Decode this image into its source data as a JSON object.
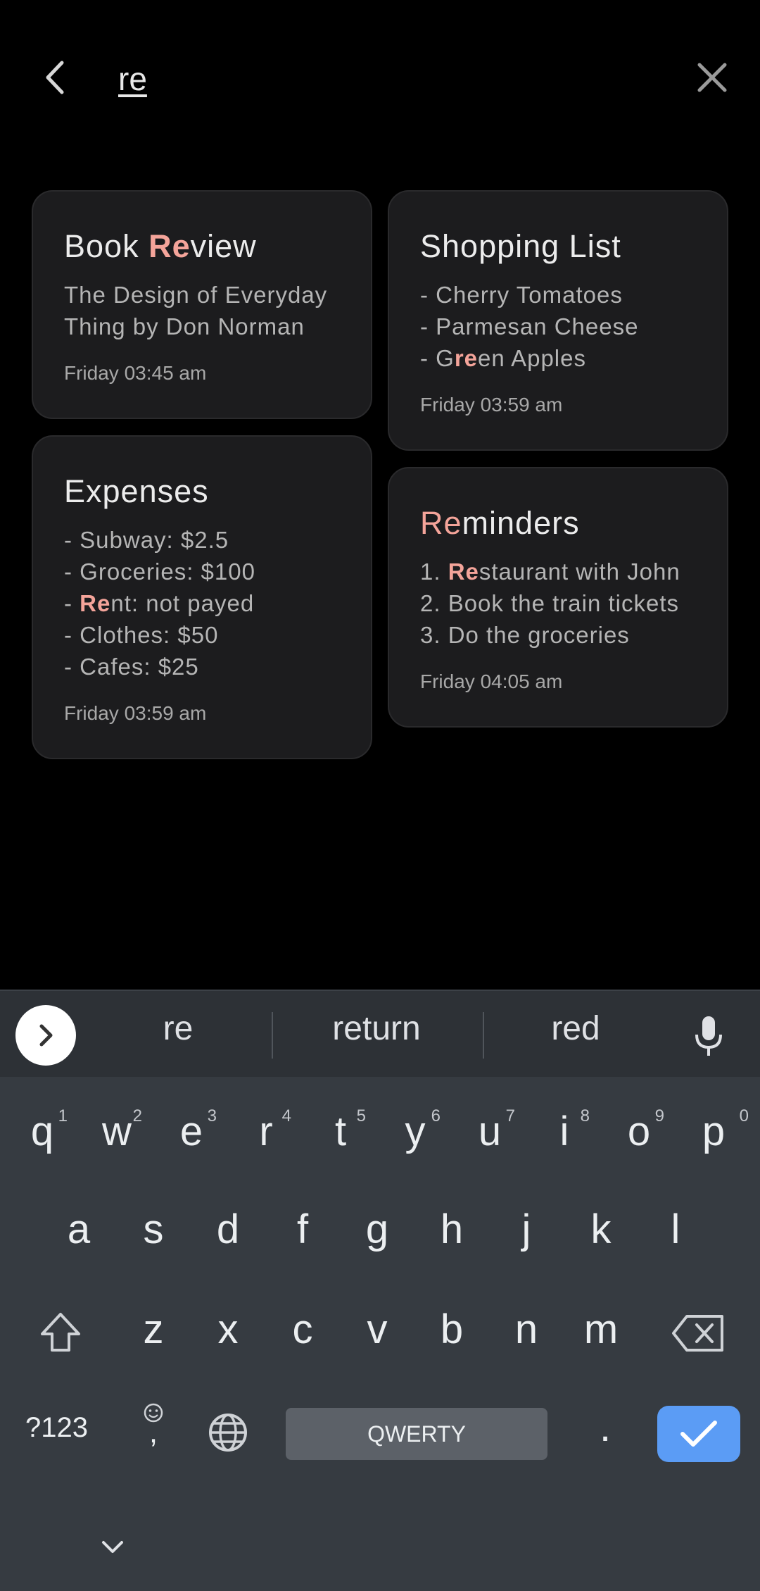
{
  "search": {
    "query": "re",
    "back_icon": "arrow-back-icon",
    "clear_icon": "close-icon"
  },
  "notes": [
    {
      "title_parts": [
        "Book ",
        "Re",
        "view"
      ],
      "body": [
        "The Design of Everyday",
        "Thing by Don Norman"
      ],
      "date": "Friday 03:45 am"
    },
    {
      "title": "Shopping List",
      "body_line1": "- Cherry Tomatoes",
      "body_line2": "- Parmesan Cheese",
      "body_line3_parts": [
        "- G",
        "re",
        "en Apples"
      ],
      "date": "Friday 03:59 am"
    },
    {
      "title": "Expenses",
      "body_line1": "- Subway: $2.5",
      "body_line2": "- Groceries: $100",
      "body_line3_parts": [
        "- ",
        "Re",
        "nt: not payed"
      ],
      "body_line4": "- Clothes: $50",
      "body_line5": "- Cafes: $25",
      "date": "Friday 03:59 am"
    },
    {
      "title_parts": [
        "Re",
        "minders"
      ],
      "body_line1_parts": [
        "1. ",
        "Re",
        "staurant with John"
      ],
      "body_line2": "2. Book the train tickets",
      "body_line3": "3. Do the groceries",
      "date": "Friday 04:05 am"
    }
  ],
  "highlight_color": "#f4a49a",
  "keyboard": {
    "suggestions": [
      "re",
      "return",
      "red"
    ],
    "row1": [
      "q",
      "w",
      "e",
      "r",
      "t",
      "y",
      "u",
      "i",
      "o",
      "p"
    ],
    "row1_nums": [
      "1",
      "2",
      "3",
      "4",
      "5",
      "6",
      "7",
      "8",
      "9",
      "0"
    ],
    "row2": [
      "a",
      "s",
      "d",
      "f",
      "g",
      "h",
      "j",
      "k",
      "l"
    ],
    "row3": [
      "z",
      "x",
      "c",
      "v",
      "b",
      "n",
      "m"
    ],
    "symbols_label": "?123",
    "comma": ",",
    "period": ".",
    "space_label": "QWERTY",
    "enter_color": "#5b9cf5"
  }
}
